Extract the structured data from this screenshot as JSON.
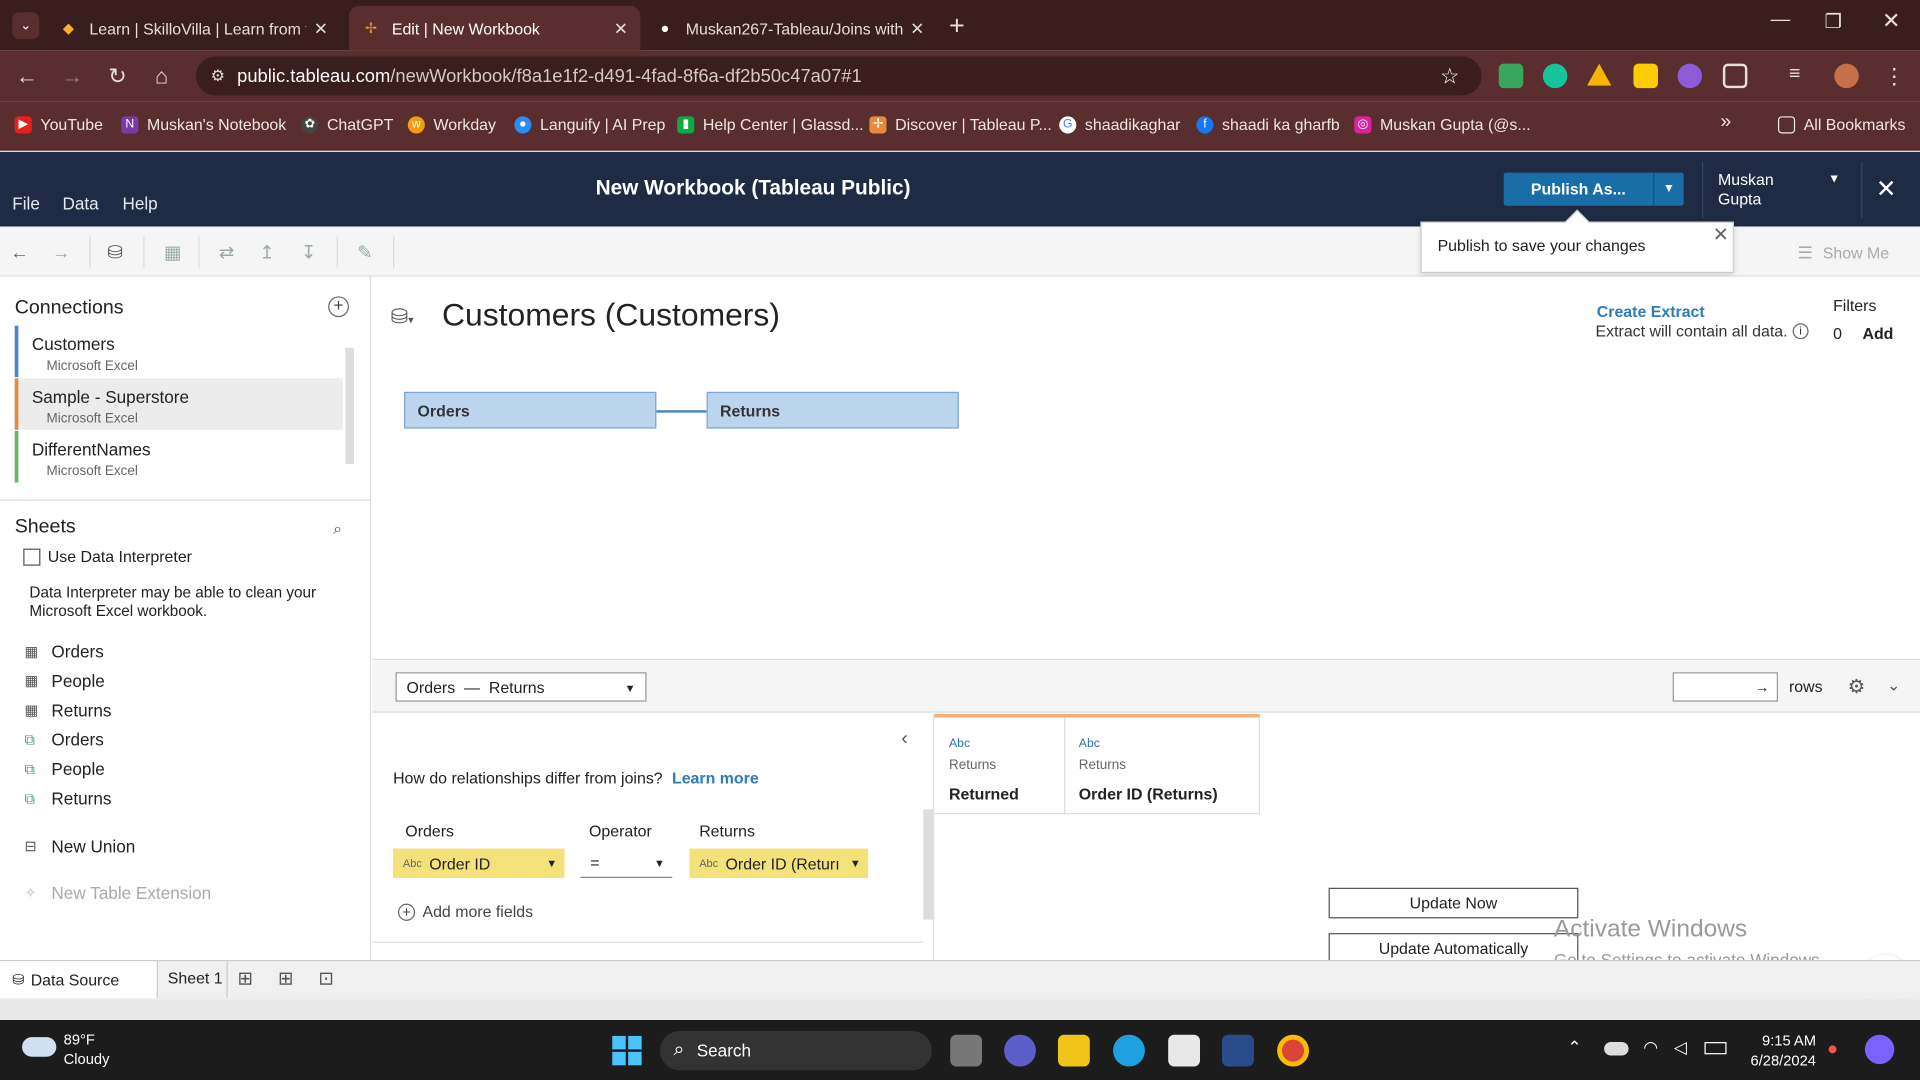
{
  "browser": {
    "tabs": [
      {
        "title": "Learn | SkilloVilla | Learn from tl"
      },
      {
        "title": "Edit | New Workbook"
      },
      {
        "title": "Muskan267-Tableau/Joins with"
      }
    ],
    "new_tab": "+",
    "url_domain": "public.tableau.com",
    "url_path": "/newWorkbook/f8a1e1f2-d491-4fad-8f6a-df2b50c47a07#1",
    "bookmarks": [
      "YouTube",
      "Muskan's Notebook",
      "ChatGPT",
      "Workday",
      "Languify | AI Prep",
      "Help Center | Glassd...",
      "Discover | Tableau P...",
      "shaadikaghar",
      "shaadi ka gharfb",
      "Muskan Gupta (@s..."
    ],
    "more_bookmarks": "»",
    "all_bookmarks": "All Bookmarks"
  },
  "app": {
    "menu": [
      "File",
      "Data",
      "Help"
    ],
    "title": "New Workbook (Tableau Public)",
    "publish_label": "Publish As...",
    "user_first": "Muskan",
    "user_last": "Gupta",
    "tooltip": "Publish to save your changes",
    "show_me": "Show Me"
  },
  "left": {
    "connections_title": "Connections",
    "connections": [
      {
        "name": "Customers",
        "source": "Microsoft Excel"
      },
      {
        "name": "Sample - Superstore",
        "source": "Microsoft Excel"
      },
      {
        "name": "DifferentNames",
        "source": "Microsoft Excel"
      }
    ],
    "sheets_title": "Sheets",
    "use_interpreter": "Use Data Interpreter",
    "interpreter_note": "Data Interpreter may be able to clean your Microsoft Excel workbook.",
    "sheets": [
      "Orders",
      "People",
      "Returns",
      "Orders",
      "People",
      "Returns"
    ],
    "new_union": "New Union",
    "new_table_extension": "New Table Extension"
  },
  "canvas": {
    "title": "Customers (Customers)",
    "create_extract": "Create Extract",
    "extract_note": "Extract will contain all data.",
    "filters_title": "Filters",
    "filters_count": "0",
    "filters_add": "Add",
    "tables": [
      "Orders",
      "Returns"
    ]
  },
  "bottom": {
    "join_left": "Orders",
    "join_dash": "—",
    "join_right": "Returns",
    "rows_label": "rows",
    "rel_question": "How do relationships differ from joins?",
    "learn_more": "Learn more",
    "col_left": "Orders",
    "col_op": "Operator",
    "col_right": "Returns",
    "left_field": "Order ID",
    "operator": "=",
    "right_field": "Order ID (Returı",
    "abc": "Abc",
    "add_more": "Add more fields",
    "grid_cols": [
      {
        "type": "Abc",
        "source": "Returns",
        "name": "Returned"
      },
      {
        "type": "Abc",
        "source": "Returns",
        "name": "Order ID (Returns)"
      }
    ],
    "update_now": "Update Now",
    "update_auto": "Update Automatically"
  },
  "sheetbar": {
    "data_source": "Data Source",
    "sheet1": "Sheet 1"
  },
  "watermark": {
    "line1": "Activate Windows",
    "line2": "Go to Settings to activate Windows."
  },
  "taskbar": {
    "temp": "89°F",
    "weather": "Cloudy",
    "search": "Search",
    "time": "9:15 AM",
    "date": "6/28/2024"
  }
}
